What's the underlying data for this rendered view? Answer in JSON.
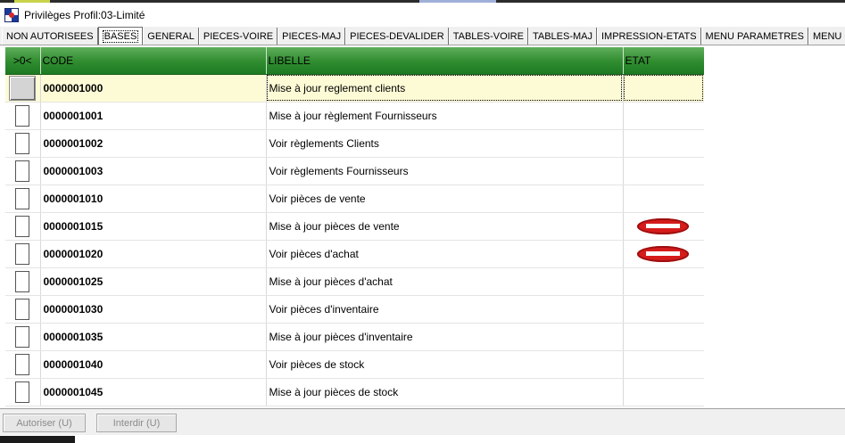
{
  "window": {
    "title": "Privilèges Profil:03-Limité"
  },
  "tabs": [
    {
      "label": "NON AUTORISEES",
      "active": false
    },
    {
      "label": "BASES",
      "active": true
    },
    {
      "label": "GENERAL",
      "active": false
    },
    {
      "label": "PIECES-VOIRE",
      "active": false
    },
    {
      "label": "PIECES-MAJ",
      "active": false
    },
    {
      "label": "PIECES-DEVALIDER",
      "active": false
    },
    {
      "label": "TABLES-VOIRE",
      "active": false
    },
    {
      "label": "TABLES-MAJ",
      "active": false
    },
    {
      "label": "IMPRESSION-ETATS",
      "active": false
    },
    {
      "label": "MENU PARAMETRES",
      "active": false
    },
    {
      "label": "MENU OUTILS",
      "active": false
    }
  ],
  "grid": {
    "columns": {
      "select": ">0<",
      "code": "CODE",
      "libelle": "LIBELLE",
      "etat": "ETAT"
    },
    "header_color": "#2f8c2f",
    "rows": [
      {
        "code": "0000001000",
        "libelle": "Mise à jour reglement  clients",
        "forbidden": false,
        "current": true
      },
      {
        "code": "0000001001",
        "libelle": "Mise à jour règlement Fournisseurs",
        "forbidden": false,
        "current": false
      },
      {
        "code": "0000001002",
        "libelle": "Voir règlements Clients",
        "forbidden": false,
        "current": false
      },
      {
        "code": "0000001003",
        "libelle": "Voir règlements Fournisseurs",
        "forbidden": false,
        "current": false
      },
      {
        "code": "0000001010",
        "libelle": "Voir pièces de vente",
        "forbidden": false,
        "current": false
      },
      {
        "code": "0000001015",
        "libelle": "Mise à jour pièces de vente",
        "forbidden": true,
        "current": false
      },
      {
        "code": "0000001020",
        "libelle": "Voir pièces d'achat",
        "forbidden": true,
        "current": false
      },
      {
        "code": "0000001025",
        "libelle": "Mise à jour pièces d'achat",
        "forbidden": false,
        "current": false
      },
      {
        "code": "0000001030",
        "libelle": "Voir pièces d'inventaire",
        "forbidden": false,
        "current": false
      },
      {
        "code": "0000001035",
        "libelle": "Mise à jour pièces d'inventaire",
        "forbidden": false,
        "current": false
      },
      {
        "code": "0000001040",
        "libelle": "Voir pièces de stock",
        "forbidden": false,
        "current": false
      },
      {
        "code": "0000001045",
        "libelle": "Mise à jour pièces de stock",
        "forbidden": false,
        "current": false
      }
    ]
  },
  "buttons": {
    "authorize": "Autoriser (U)",
    "forbid": "Interdir (U)"
  },
  "icons": {
    "app": "app-window-icon",
    "forbidden": "no-entry-icon"
  }
}
